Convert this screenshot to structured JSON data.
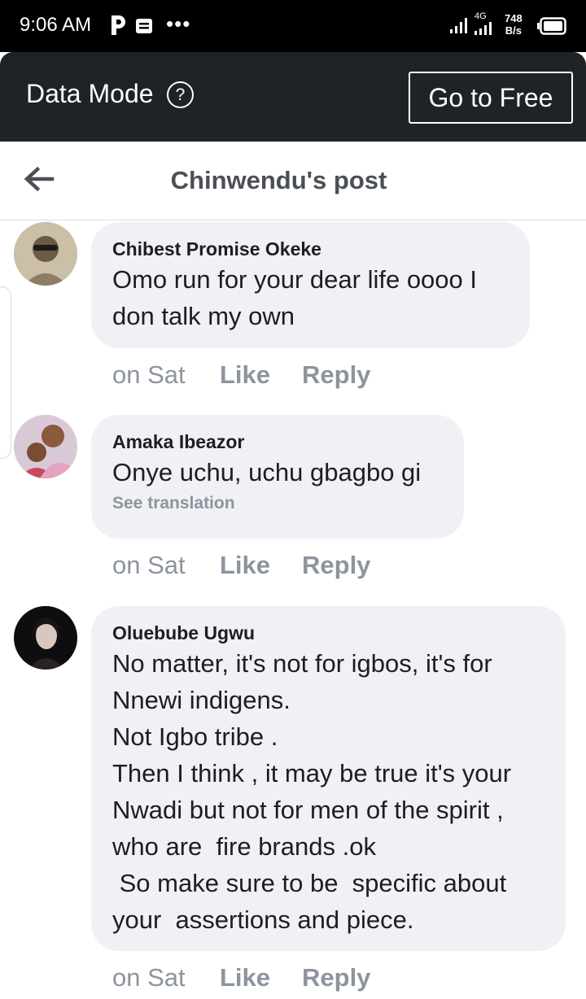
{
  "status_bar": {
    "time": "9:06 AM",
    "network": "4G",
    "speed_value": "748",
    "speed_unit": "B/s",
    "icons": [
      "pocket-icon",
      "message-icon",
      "more-dots-icon",
      "signal-icon",
      "battery-icon"
    ]
  },
  "data_mode": {
    "label": "Data Mode",
    "help": "?",
    "button": "Go to Free"
  },
  "header": {
    "title": "Chinwendu's post"
  },
  "comments": [
    {
      "name": "Chibest Promise Okeke",
      "text": "Omo run for your dear life oooo I\ndon talk my own",
      "time": "on Sat",
      "like": "Like",
      "reply": "Reply"
    },
    {
      "name": "Amaka Ibeazor",
      "text": "Onye uchu, uchu gbagbo gi",
      "translation": "See translation",
      "time": "on Sat",
      "like": "Like",
      "reply": "Reply"
    },
    {
      "name": "Oluebube Ugwu",
      "text": "No matter, it's not for igbos, it's for\nNnewi indigens.\nNot Igbo tribe .\nThen I think , it may be true it's your\nNwadi but not for men of the spirit ,\nwho are  fire brands .ok\n So make sure to be  specific about\nyour  assertions and piece.",
      "time": "on Sat",
      "like": "Like",
      "reply": "Reply"
    }
  ],
  "colors": {
    "status_bg": "#000000",
    "data_bar_bg": "#1f2326",
    "bubble_bg": "#eff1f5",
    "meta_text": "#8d949e",
    "title_text": "#4b4f56"
  }
}
